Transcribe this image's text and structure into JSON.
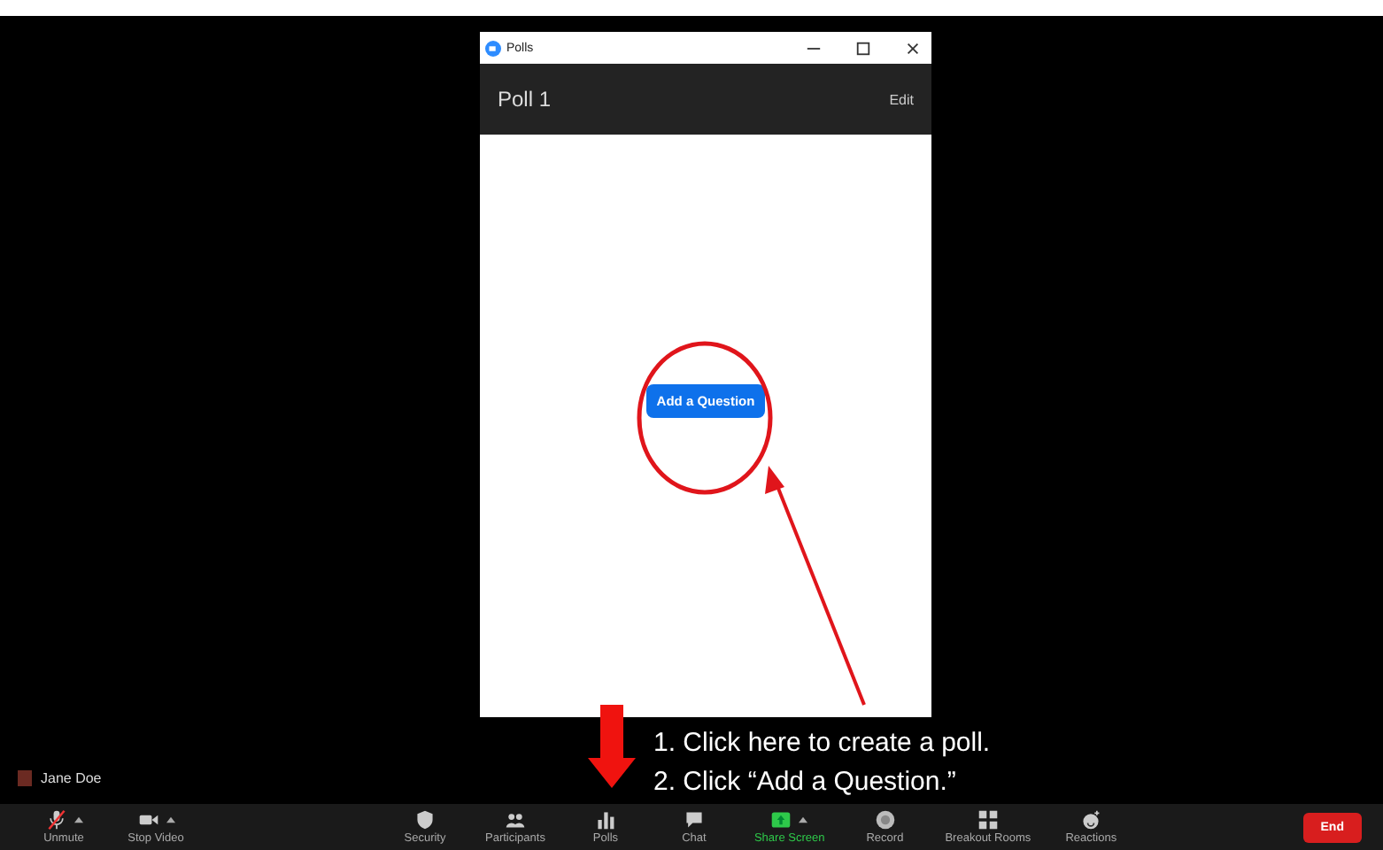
{
  "polls_window": {
    "title": "Polls",
    "poll_title": "Poll 1",
    "edit": "Edit",
    "add_button": "Add a Question"
  },
  "instructions": [
    "1. Click here to create a poll.",
    "2. Click “Add a Question.”"
  ],
  "name_tag": "Jane Doe",
  "toolbar": [
    {
      "kind": "mic",
      "label": "Unmute",
      "caret": true
    },
    {
      "kind": "video",
      "label": "Stop Video",
      "caret": true
    },
    {
      "kind": "shield",
      "label": "Security",
      "caret": false
    },
    {
      "kind": "people",
      "label": "Participants",
      "caret": false
    },
    {
      "kind": "polls",
      "label": "Polls",
      "caret": false
    },
    {
      "kind": "chat",
      "label": "Chat",
      "caret": false
    },
    {
      "kind": "share",
      "label": "Share Screen",
      "caret": true
    },
    {
      "kind": "record",
      "label": "Record",
      "caret": false
    },
    {
      "kind": "grid",
      "label": "Breakout Rooms",
      "caret": false
    },
    {
      "kind": "reaction",
      "label": "Reactions",
      "caret": false
    }
  ],
  "end_button": "End"
}
